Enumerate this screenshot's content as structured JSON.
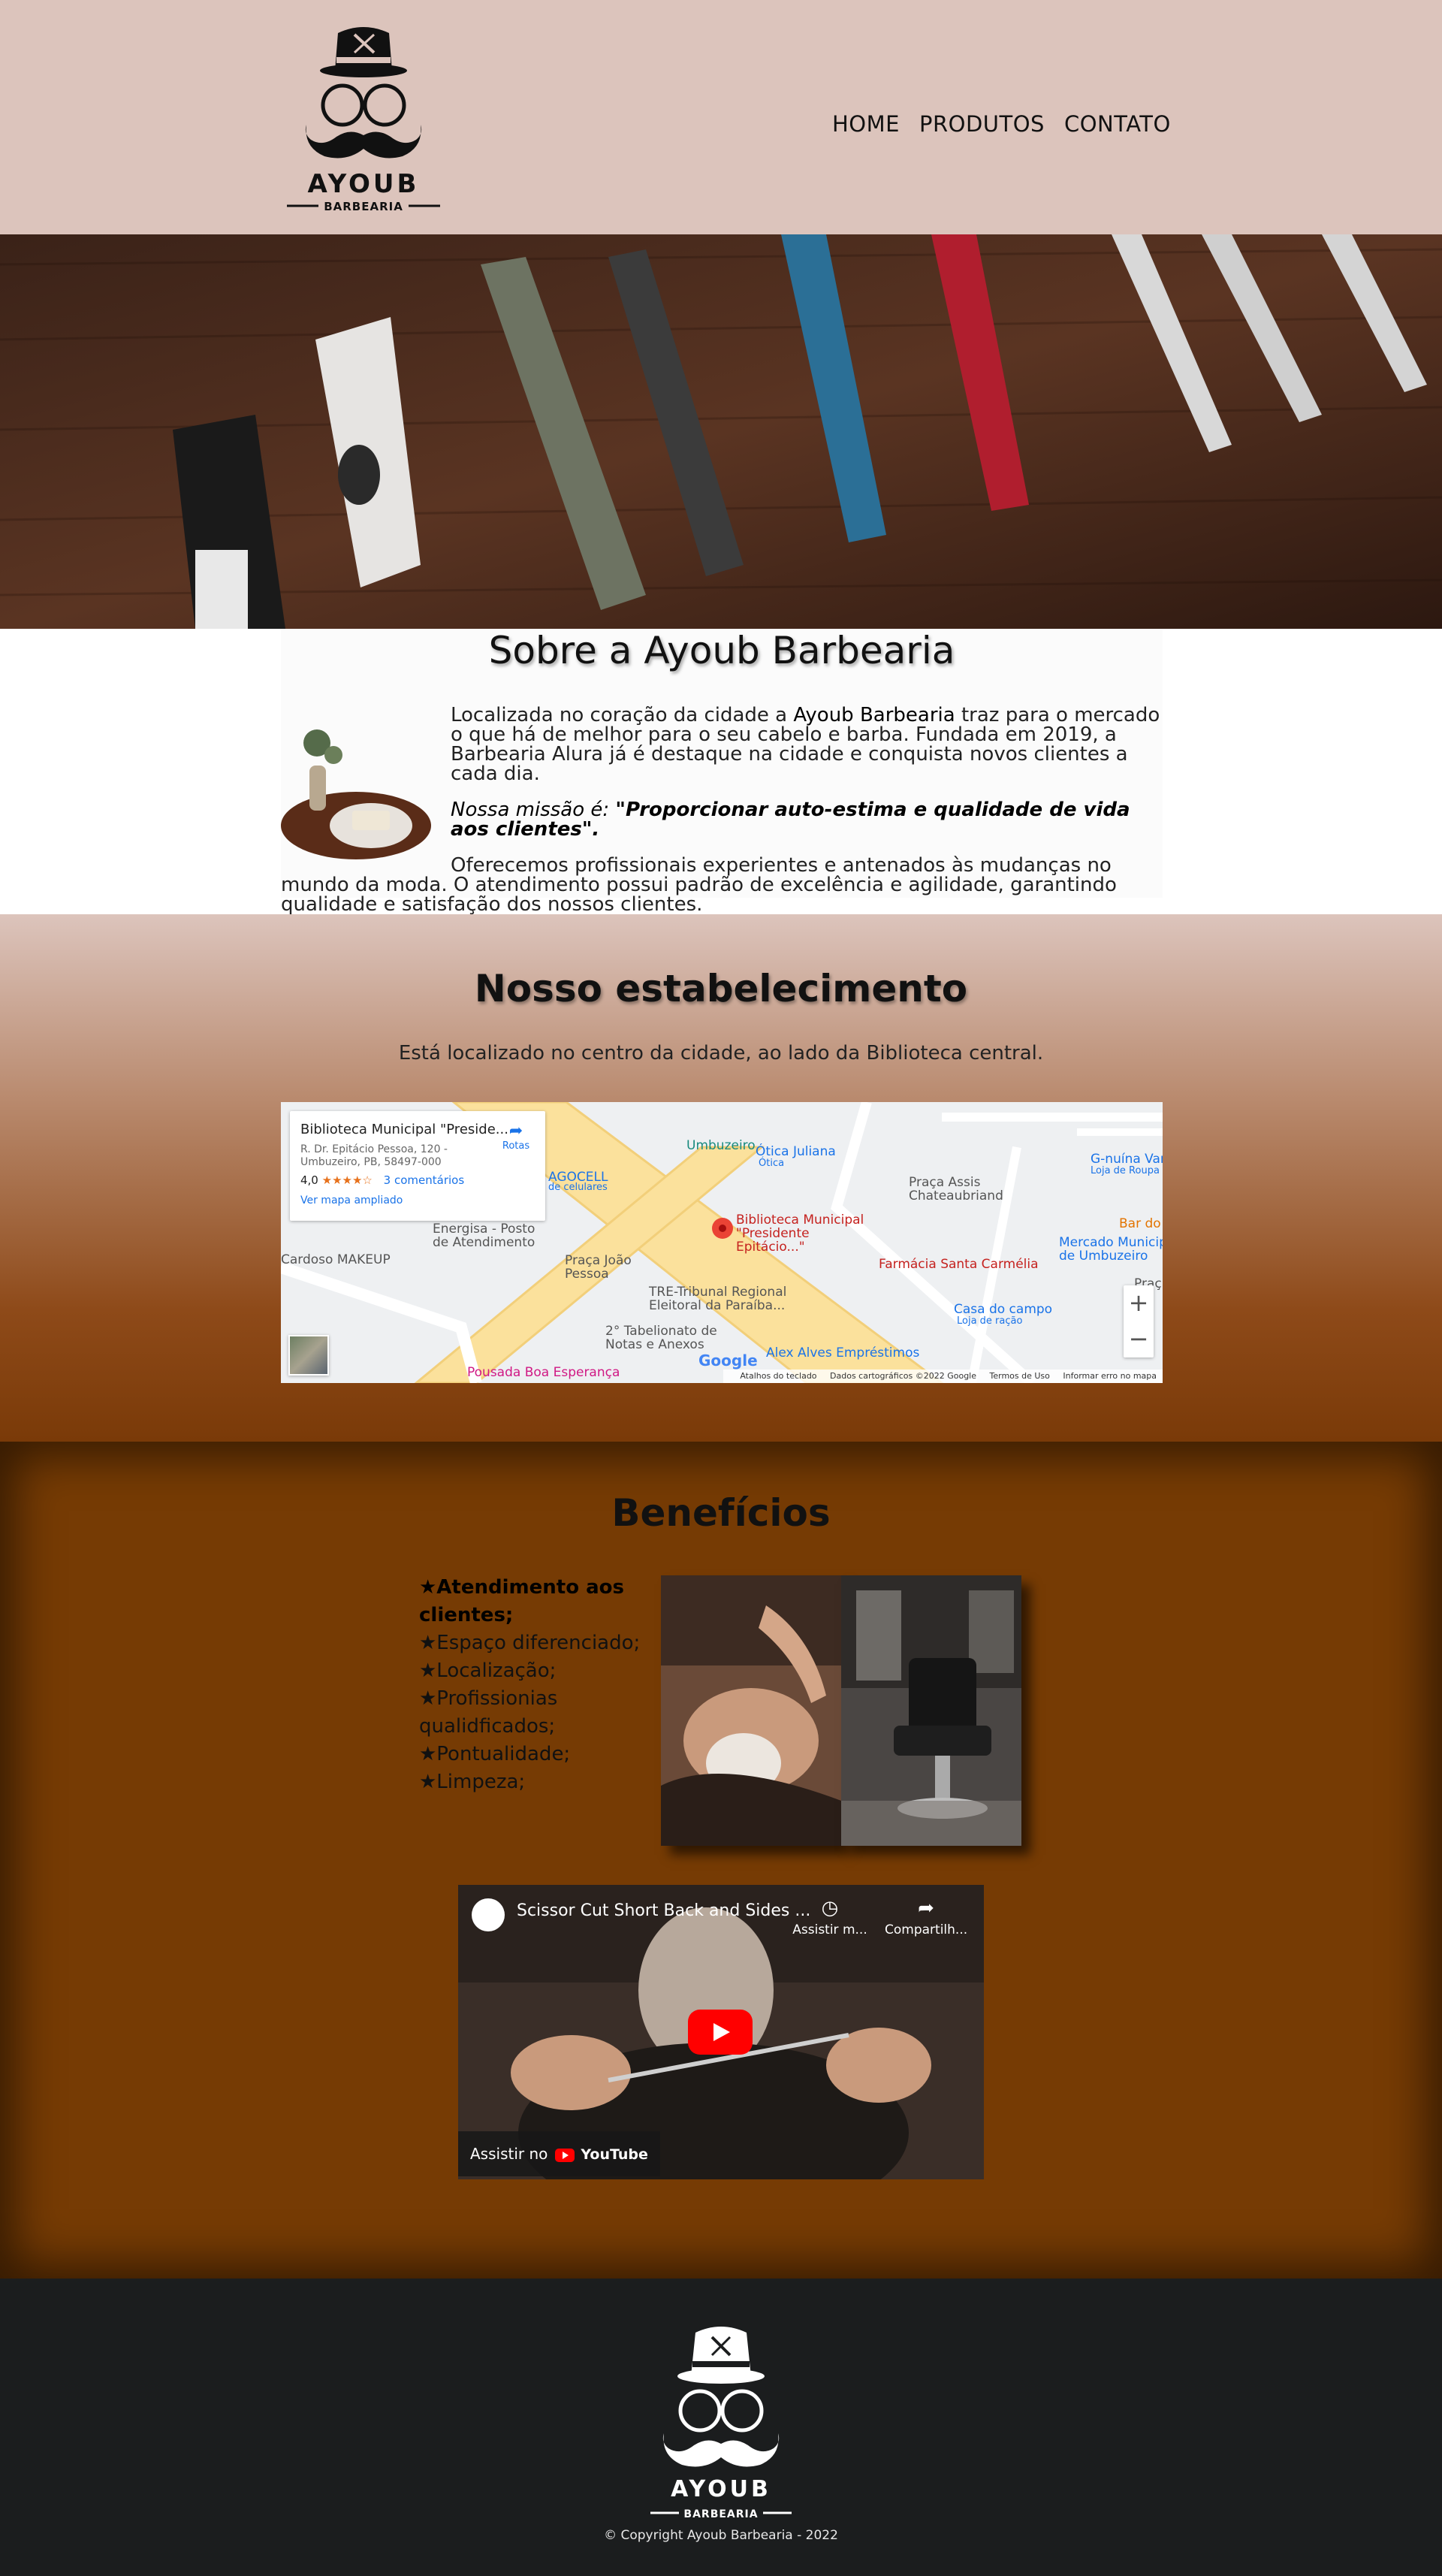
{
  "colors": {
    "header_bg": "#dcc4bc",
    "benefits_bg": "#763b04",
    "footer_bg": "#1b1d1e",
    "accent_brown": "#8e4a19"
  },
  "brand": {
    "name": "AYOUB",
    "tagline": "BARBEARIA"
  },
  "nav": {
    "items": [
      "HOME",
      "PRODUTOS",
      "CONTATO"
    ]
  },
  "about": {
    "title": "Sobre a Ayoub Barbearia",
    "p1_before": "Localizada no coração da cidade a ",
    "p1_brand": "Ayoub Barbearia",
    "p1_after": " traz para o mercado o que há de melhor para o seu cabelo e barba. Fundada em 2019, a Barbearia Alura já é destaque na cidade e conquista novos clientes a cada dia.",
    "mission_label": "Nossa missão é: ",
    "mission_text": "\"Proporcionar auto-estima e qualidade de vida aos clientes\".",
    "p3": "Oferecemos profissionais experientes e antenados às mudanças no mundo da moda. O atendimento possui padrão de excelência e agilidade, garantindo qualidade e satisfação dos nossos clientes."
  },
  "establishment": {
    "title": "Nosso estabelecimento",
    "subtitle": "Está localizado no centro da cidade, ao lado da Biblioteca central.",
    "map": {
      "place_name": "Biblioteca Municipal \"Preside...",
      "address": "R. Dr. Epitácio Pessoa, 120 - Umbuzeiro, PB, 58497-000",
      "rating": "4,0",
      "stars": "★★★★☆",
      "reviews": "3 comentários",
      "enlarge": "Ver mapa ampliado",
      "directions": "Rotas",
      "labels": {
        "umbuzeiro": "Umbuzeiro",
        "otica": "Ótica Juliana",
        "otica2": "Ótica",
        "agocell": "AGOCELL",
        "agocell2": "de celulares",
        "praca_assis": "Praça Assis Chateaubriand",
        "gnuina": "G-nuína Vari",
        "gnuina2": "Loja de Roupa",
        "bardo": "Bar do",
        "energisa": "Energisa - Posto de Atendimento",
        "biblioteca": "Biblioteca Municipal \"Presidente Epitácio...\"",
        "mercado": "Mercado Municip de Umbuzeiro",
        "cardoso": "Cardoso MAKEUP",
        "praca_joao": "Praça João Pessoa",
        "farmacia": "Farmácia Santa Carmélia",
        "tre": "TRE-Tribunal Regional Eleitoral da Paraíba...",
        "casa": "Casa do campo",
        "casa2": "Loja de ração",
        "praca_r": "Praç",
        "tabelionato": "2° Tabelionato de Notas e Anexos",
        "alex": "Alex Alves Empréstimos",
        "pousada": "Pousada Boa Esperança"
      },
      "google": "Google",
      "footer_keys": "Atalhos do teclado",
      "footer_data": "Dados cartográficos ©2022 Google",
      "footer_terms": "Termos de Uso",
      "footer_report": "Informar erro no mapa",
      "zoom_in": "+",
      "zoom_out": "−"
    }
  },
  "benefits": {
    "title": "Benefícios",
    "items": [
      "★Atendimento aos clientes;",
      "★Espaço diferenciado;",
      "★Localização;",
      "★Profissionias qualidficados;",
      "★Pontualidade;",
      "★Limpeza;"
    ]
  },
  "video": {
    "title": "Scissor Cut Short Back and Sides ...",
    "watch_later": "Assistir m...",
    "share": "Compartilh...",
    "watch_on": "Assistir no",
    "youtube": "YouTube"
  },
  "footer": {
    "copyright": "© Copyright Ayoub Barbearia - 2022"
  }
}
